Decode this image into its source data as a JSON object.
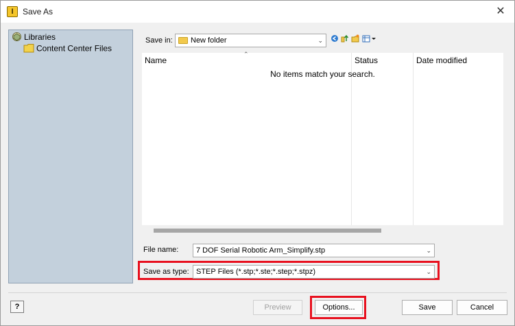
{
  "window": {
    "title": "Save As",
    "app_icon": "inventor-app-icon",
    "close_glyph": "✕"
  },
  "places": {
    "items": [
      {
        "label": "Libraries",
        "icon": "libraries-icon"
      },
      {
        "label": "Content Center Files",
        "icon": "folder-icon"
      }
    ]
  },
  "save_in": {
    "label": "Save in:",
    "value": "New folder"
  },
  "toolbar": {
    "icons": [
      "back-icon",
      "up-folder-icon",
      "new-folder-icon",
      "view-menu-icon"
    ]
  },
  "file_list": {
    "columns": [
      "Name",
      "Status",
      "Date modified"
    ],
    "empty_message": "No items match your search."
  },
  "file_name": {
    "label": "File name:",
    "value": "7 DOF Serial Robotic Arm_Simplify.stp"
  },
  "save_as_type": {
    "label": "Save as type:",
    "value": "STEP Files (*.stp;*.ste;*.step;*.stpz)"
  },
  "buttons": {
    "help": "?",
    "preview": "Preview",
    "options": "Options...",
    "save": "Save",
    "cancel": "Cancel"
  },
  "highlight_color": "#e8101e"
}
